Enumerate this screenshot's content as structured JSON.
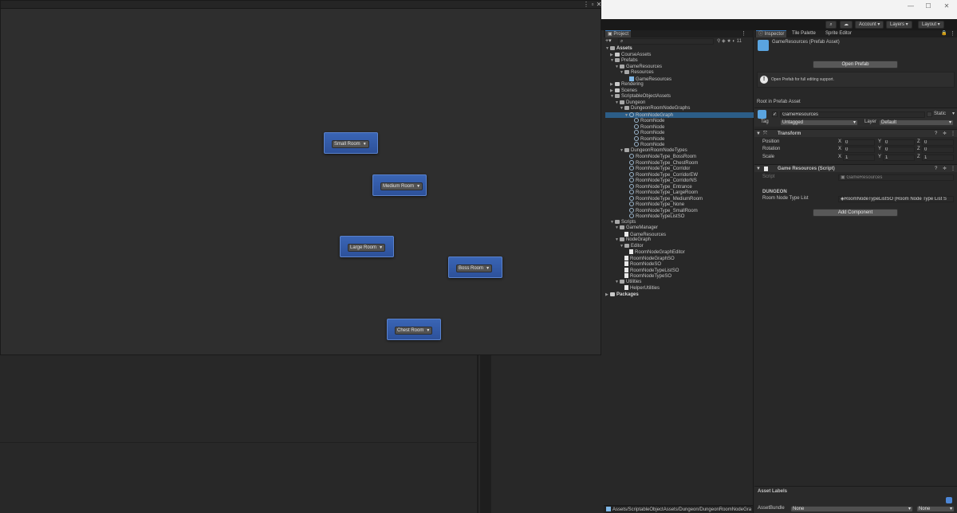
{
  "graph": {
    "nodes": [
      {
        "label": "Small Room"
      },
      {
        "label": "Medium Room"
      },
      {
        "label": "Large Room"
      },
      {
        "label": "Boss Room"
      },
      {
        "label": "Chest Room"
      }
    ]
  },
  "toolbar": {
    "account": "Account",
    "layers": "Layers",
    "layout": "Layout"
  },
  "project": {
    "tab": "Project",
    "tree": [
      {
        "label": "Assets",
        "bold": true
      },
      {
        "label": "CourseAssets"
      },
      {
        "label": "Prefabs"
      },
      {
        "label": "GameResources"
      },
      {
        "label": "Resources"
      },
      {
        "label": "GameResources"
      },
      {
        "label": "Rendering"
      },
      {
        "label": "Scenes"
      },
      {
        "label": "ScriptableObjectAssets"
      },
      {
        "label": "Dungeon"
      },
      {
        "label": "DungeonRoomNodeGraphs"
      },
      {
        "label": "RoomNodeGraph"
      },
      {
        "label": "RoomNode"
      },
      {
        "label": "RoomNode"
      },
      {
        "label": "RoomNode"
      },
      {
        "label": "RoomNode"
      },
      {
        "label": "RoomNode"
      },
      {
        "label": "DungeonRoomNodeTypes"
      },
      {
        "label": "RoomNodeType_BossRoom"
      },
      {
        "label": "RoomNodeType_ChestRoom"
      },
      {
        "label": "RoomNodeType_Corridor"
      },
      {
        "label": "RoomNodeType_CorridorEW"
      },
      {
        "label": "RoomNodeType_CorridorNS"
      },
      {
        "label": "RoomNodeType_Entrance"
      },
      {
        "label": "RoomNodeType_LargeRoom"
      },
      {
        "label": "RoomNodeType_MediumRoom"
      },
      {
        "label": "RoomNodeType_None"
      },
      {
        "label": "RoomNodeType_SmallRoom"
      },
      {
        "label": "RoomNodeTypeListSO"
      },
      {
        "label": "Scripts"
      },
      {
        "label": "GameManager"
      },
      {
        "label": "GameResources"
      },
      {
        "label": "NodeGraph"
      },
      {
        "label": "Editor"
      },
      {
        "label": "RoomNodeGraphEditor"
      },
      {
        "label": "RoomNodeGraphSO"
      },
      {
        "label": "RoomNodeSO"
      },
      {
        "label": "RoomNodeTypeListSO"
      },
      {
        "label": "RoomNodeTypeSO"
      },
      {
        "label": "Utilities"
      },
      {
        "label": "HelperUtilities"
      },
      {
        "label": "Packages",
        "bold": true
      }
    ],
    "path": "Assets/ScriptableObjectAssets/Dungeon/DungeonRoomNodeGra"
  },
  "inspector": {
    "tabs": [
      "Inspector",
      "Tile Palette",
      "Sprite Editor"
    ],
    "title": "GameResources (Prefab Asset)",
    "open_prefab": "Open Prefab",
    "info": "Open Prefab for full editing support.",
    "root_label": "Root in Prefab Asset",
    "object_name": "GameResources",
    "static_label": "Static",
    "tag_label": "Tag",
    "tag_value": "Untagged",
    "layer_label": "Layer",
    "layer_value": "Default",
    "transform_title": "Transform",
    "position_label": "Position",
    "rotation_label": "Rotation",
    "scale_label": "Scale",
    "position": [
      "0",
      "0",
      "0"
    ],
    "rotation": [
      "0",
      "0",
      "0"
    ],
    "scale": [
      "1",
      "1",
      "1"
    ],
    "axis": [
      "X",
      "Y",
      "Z"
    ],
    "script_comp_title": "Game Resources (Script)",
    "script_label": "Script",
    "script_value": "GameResources",
    "section_header": "DUNGEON",
    "room_list_label": "Room Node Type List",
    "room_list_value": "RoomNodeTypeListSO (Room Node Type List S",
    "add_component": "Add Component",
    "asset_labels": "Asset Labels",
    "asset_bundle_label": "AssetBundle",
    "asset_bundle_value": "None",
    "asset_variant_value": "None"
  }
}
